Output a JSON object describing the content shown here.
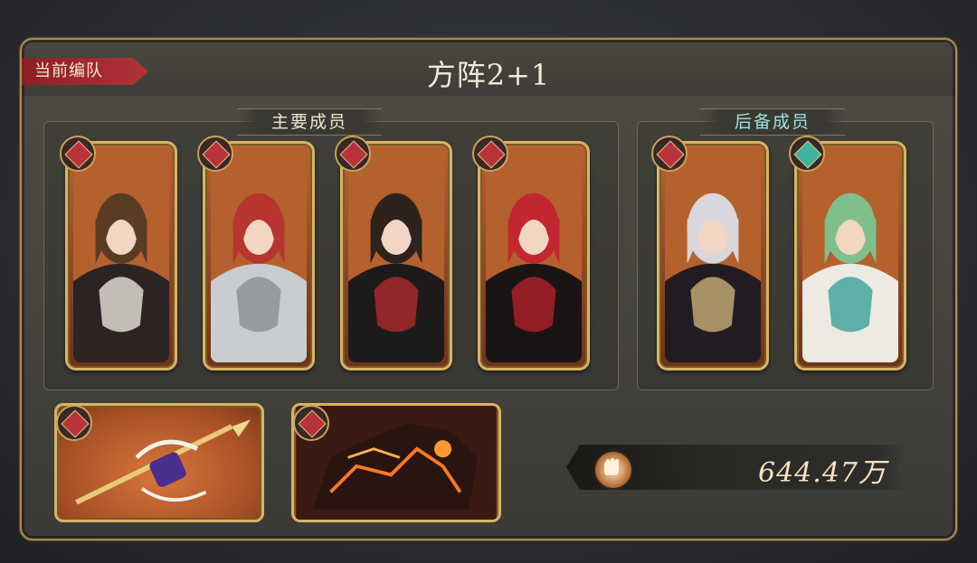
{
  "header": {
    "team_tag": "当前编队",
    "formation_title": "方阵2+1"
  },
  "groups": {
    "main_label": "主要成员",
    "reserve_label": "后备成员"
  },
  "main_members": [
    {
      "element": "fire-icon",
      "hair": "#5a3b24",
      "outfit": "#2b2422",
      "accent": "#e8e3db"
    },
    {
      "element": "fire-icon",
      "hair": "#b8342e",
      "outfit": "#c9ccd0",
      "accent": "#8a8e94"
    },
    {
      "element": "fire-icon",
      "hair": "#2d221c",
      "outfit": "#1d1a1a",
      "accent": "#b0282a"
    },
    {
      "element": "fire-icon",
      "hair": "#c2262e",
      "outfit": "#1a1414",
      "accent": "#b3212b"
    }
  ],
  "reserve_members": [
    {
      "element": "fire-icon",
      "hair": "#d9d6dc",
      "outfit": "#221c22",
      "accent": "#c9b07a"
    },
    {
      "element": "wind-icon",
      "hair": "#7fbf8e",
      "outfit": "#eceae3",
      "accent": "#3aa39a"
    }
  ],
  "equipment": [
    {
      "element": "fire-icon",
      "name": "spear-weapon-icon"
    },
    {
      "element": "fire-icon",
      "name": "lava-beast-icon"
    }
  ],
  "power": {
    "icon": "fist-icon",
    "value": "644.47万"
  },
  "colors": {
    "fire": "#b8333a",
    "wind": "#3fb39c",
    "frame_gold": "#d7b465"
  }
}
